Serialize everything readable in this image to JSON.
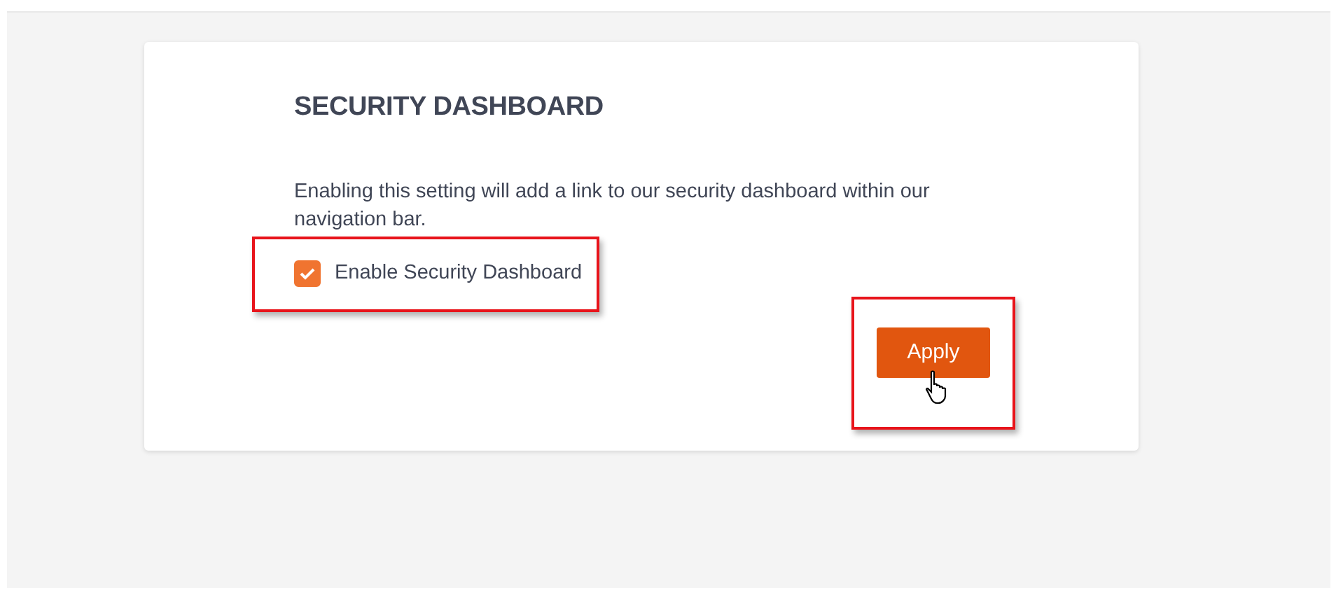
{
  "card": {
    "title": "SECURITY DASHBOARD",
    "description": "Enabling this setting will add a link to our security dashboard within our navigation bar.",
    "checkbox": {
      "label": "Enable Security Dashboard",
      "checked": true,
      "highlighted": true
    },
    "apply_button": {
      "label": "Apply",
      "highlighted": true,
      "hovered": true
    }
  }
}
